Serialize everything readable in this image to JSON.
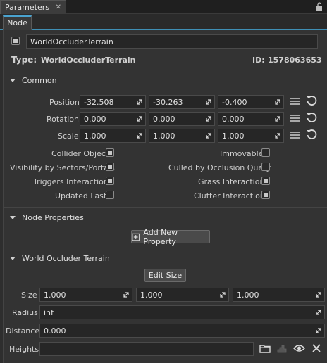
{
  "window": {
    "tab_title": "Parameters",
    "close_glyph": "✕",
    "lock_icon": "lock-icon"
  },
  "subtab": {
    "label": "Node"
  },
  "node": {
    "enabled": true,
    "name": "WorldOccluderTerrain",
    "type_label": "Type:",
    "type_value": "WorldOccluderTerrain",
    "id_label": "ID:",
    "id_value": "1578063653"
  },
  "common": {
    "title": "Common",
    "position": {
      "label": "Position",
      "values": [
        "-32.508",
        "-30.263",
        "-0.400"
      ]
    },
    "rotation": {
      "label": "Rotation",
      "values": [
        "0.000",
        "0.000",
        "0.000"
      ]
    },
    "scale": {
      "label": "Scale",
      "values": [
        "1.000",
        "1.000",
        "1.000"
      ]
    },
    "flags": [
      {
        "label": "Collider Object",
        "checked": true
      },
      {
        "label": "Immovable",
        "checked": false
      },
      {
        "label": "Visibility by Sectors/Portals",
        "checked": true
      },
      {
        "label": "Culled by Occlusion Query",
        "checked": false
      },
      {
        "label": "Triggers Interaction",
        "checked": true
      },
      {
        "label": "Grass Interaction",
        "checked": true
      },
      {
        "label": "Updated Last",
        "checked": false
      },
      {
        "label": "Clutter Interaction",
        "checked": true
      }
    ]
  },
  "node_properties": {
    "title": "Node Properties",
    "add_button": "Add New Property"
  },
  "world_occluder_terrain": {
    "title": "World Occluder Terrain",
    "edit_size_button": "Edit Size",
    "size": {
      "label": "Size",
      "values": [
        "1.000",
        "1.000",
        "1.000"
      ]
    },
    "radius": {
      "label": "Radius",
      "value": "inf"
    },
    "distance": {
      "label": "Distance",
      "value": "0.000"
    },
    "heights": {
      "label": "Heights",
      "value": ""
    }
  },
  "colors": {
    "accent": "#4aa3cf",
    "background": "#333333",
    "field_bg": "#262626"
  }
}
